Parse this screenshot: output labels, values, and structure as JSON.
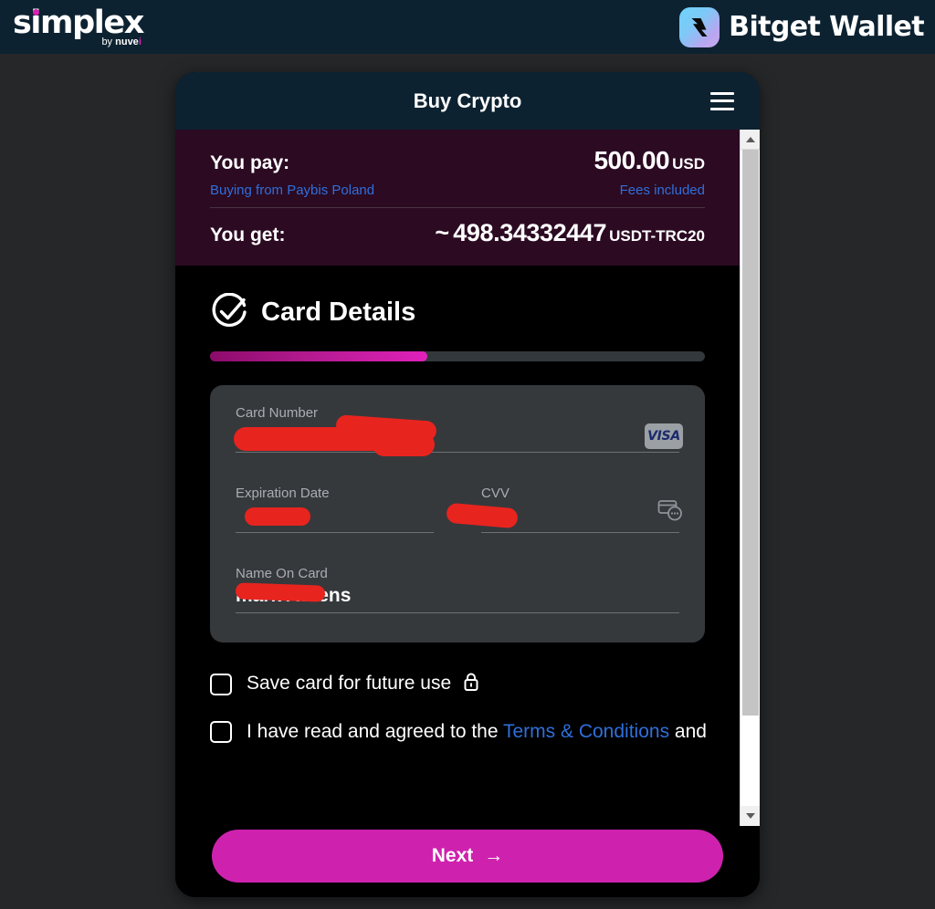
{
  "brand": {
    "simplex_name": "simplex",
    "simplex_sub_by": "by ",
    "simplex_sub_name": "nuve",
    "simplex_sub_dot": "i",
    "partner_name": "Bitget Wallet",
    "accent_magenta": "#d81fb0",
    "topbar_bg": "#0d2231"
  },
  "widget": {
    "title": "Buy Crypto",
    "menu_icon": "hamburger-menu-icon"
  },
  "summary": {
    "pay_label": "You pay:",
    "pay_amount": "500.00",
    "pay_currency": "USD",
    "source_link": "Buying from Paybis Poland",
    "fees_link": "Fees included",
    "get_label": "You get:",
    "get_approx": "~",
    "get_amount": "498.34332447",
    "get_currency": "USDT-TRC20",
    "panel_bg": "#2b0a22",
    "link_color": "#2f6fdb"
  },
  "section": {
    "title": "Card Details",
    "status_icon": "check-circle-icon",
    "progress_percent": 44,
    "progress_start_color": "#8c0b6a",
    "progress_end_color": "#e021bb"
  },
  "form": {
    "card_number": {
      "label": "Card Number",
      "value": "",
      "redacted": true,
      "brand_icon": "visa-logo-icon",
      "brand_text": "VISA"
    },
    "expiration": {
      "label": "Expiration Date",
      "value": "",
      "redacted": true
    },
    "cvv": {
      "label": "CVV",
      "value": "",
      "redacted": true,
      "help_icon": "cvv-card-icon"
    },
    "name_on_card": {
      "label": "Name On Card",
      "value": "mark Athens",
      "redacted": true
    }
  },
  "checkboxes": [
    {
      "label": "Save card for future use",
      "icon": "lock-icon",
      "checked": false
    },
    {
      "label_before": "I have read and agreed to the ",
      "link": "Terms & Conditions",
      "label_after": " and",
      "checked": false
    }
  ],
  "footer": {
    "next_label": "Next",
    "next_arrow": "→",
    "next_color": "#ce22ae"
  },
  "scrollbar": {
    "up_icon": "scroll-up-arrow-icon",
    "down_icon": "scroll-down-arrow-icon"
  }
}
